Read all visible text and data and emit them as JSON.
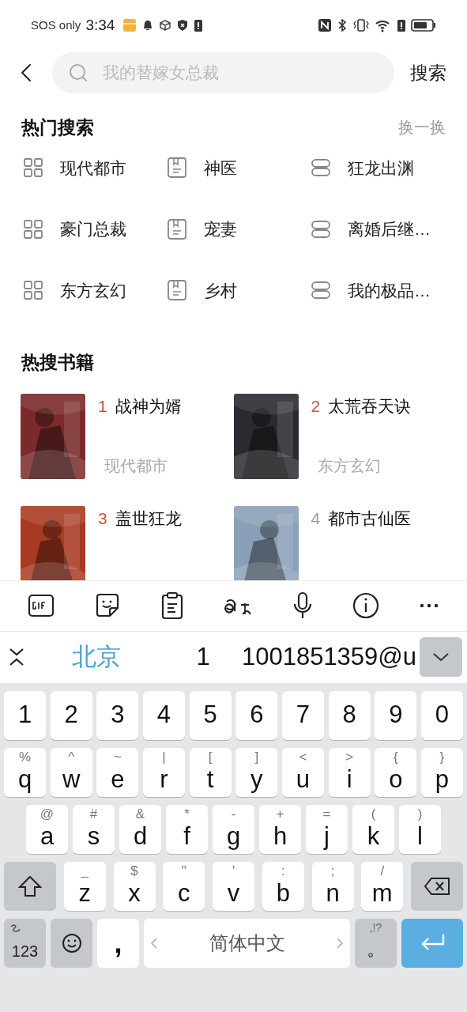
{
  "status_bar": {
    "carrier": "SOS only",
    "time": "3:34"
  },
  "search": {
    "placeholder": "我的替嫁女总裁",
    "button": "搜索"
  },
  "hot_search": {
    "title": "热门搜索",
    "refresh": "换一换",
    "items": [
      {
        "label": "现代都市",
        "kind": "category"
      },
      {
        "label": "神医",
        "kind": "book"
      },
      {
        "label": "狂龙出渊",
        "kind": "list"
      },
      {
        "label": "豪门总裁",
        "kind": "category"
      },
      {
        "label": "宠妻",
        "kind": "book"
      },
      {
        "label": "离婚后继…",
        "kind": "list"
      },
      {
        "label": "东方玄幻",
        "kind": "category"
      },
      {
        "label": "乡村",
        "kind": "book"
      },
      {
        "label": "我的极品…",
        "kind": "list"
      }
    ]
  },
  "hot_books": {
    "title": "热搜书籍",
    "books": [
      {
        "rank": "1",
        "title": "战神为婿",
        "genre": "现代都市",
        "color": "#c8553a"
      },
      {
        "rank": "2",
        "title": "太荒吞天诀",
        "genre": "东方玄幻",
        "color": "#c8553a"
      },
      {
        "rank": "3",
        "title": "盖世狂龙",
        "color": "#c8553a"
      },
      {
        "rank": "4",
        "title": "都市古仙医",
        "color": "#9a9a9a"
      }
    ]
  },
  "keyboard": {
    "suggestions": [
      {
        "text": "北京",
        "selected": true
      },
      {
        "text": "1",
        "selected": false
      },
      {
        "text": "1001851359@u",
        "selected": false
      }
    ],
    "rows": [
      [
        {
          "key": "1"
        },
        {
          "key": "2"
        },
        {
          "key": "3"
        },
        {
          "key": "4"
        },
        {
          "key": "5"
        },
        {
          "key": "6"
        },
        {
          "key": "7"
        },
        {
          "key": "8"
        },
        {
          "key": "9"
        },
        {
          "key": "0"
        }
      ],
      [
        {
          "key": "q",
          "hint": "%"
        },
        {
          "key": "w",
          "hint": "^"
        },
        {
          "key": "e",
          "hint": "~"
        },
        {
          "key": "r",
          "hint": "|"
        },
        {
          "key": "t",
          "hint": "["
        },
        {
          "key": "y",
          "hint": "]"
        },
        {
          "key": "u",
          "hint": "<"
        },
        {
          "key": "i",
          "hint": ">"
        },
        {
          "key": "o",
          "hint": "{"
        },
        {
          "key": "p",
          "hint": "}"
        }
      ],
      [
        {
          "key": "a",
          "hint": "@"
        },
        {
          "key": "s",
          "hint": "#"
        },
        {
          "key": "d",
          "hint": "&"
        },
        {
          "key": "f",
          "hint": "*"
        },
        {
          "key": "g",
          "hint": "-"
        },
        {
          "key": "h",
          "hint": "+"
        },
        {
          "key": "j",
          "hint": "="
        },
        {
          "key": "k",
          "hint": "("
        },
        {
          "key": "l",
          "hint": ")"
        }
      ],
      [
        {
          "key": "z",
          "hint": "_"
        },
        {
          "key": "x",
          "hint": "$"
        },
        {
          "key": "c",
          "hint": "\""
        },
        {
          "key": "v",
          "hint": "'"
        },
        {
          "key": "b",
          "hint": ":"
        },
        {
          "key": "n",
          "hint": ";"
        },
        {
          "key": "m",
          "hint": "/"
        }
      ]
    ],
    "mode_key": "123",
    "comma_key": ",",
    "space_key": "简体中文",
    "period_key": "。",
    "period_hint": ",!?"
  }
}
